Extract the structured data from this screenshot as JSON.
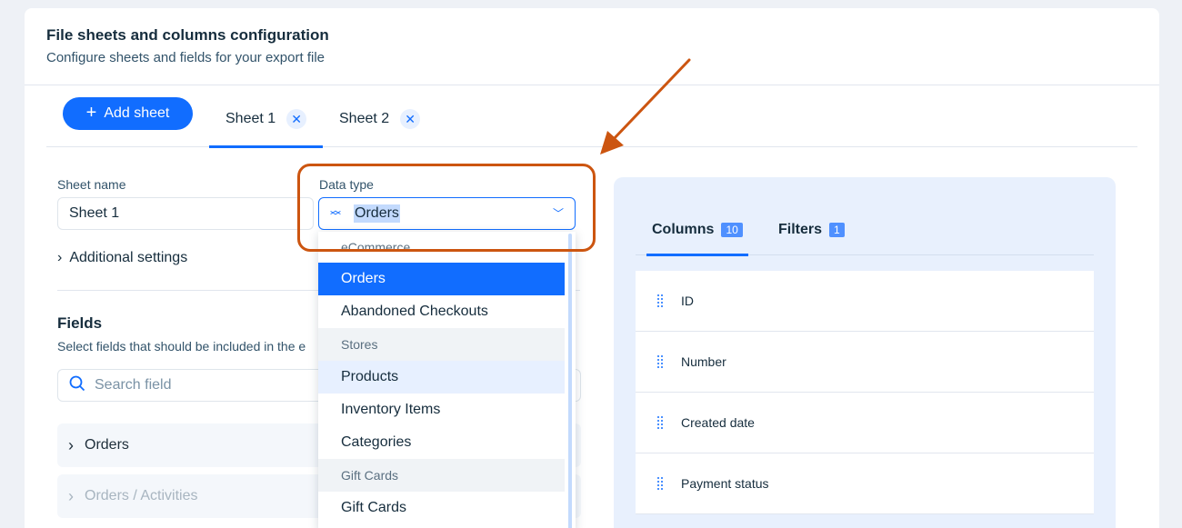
{
  "header": {
    "title": "File sheets and columns configuration",
    "subtitle": "Configure sheets and fields for your export file"
  },
  "tabs": {
    "add_label": "Add sheet",
    "sheets": [
      "Sheet 1",
      "Sheet 2"
    ]
  },
  "form": {
    "sheet_name_label": "Sheet name",
    "sheet_name_value": "Sheet 1",
    "data_type_label": "Data type",
    "data_type_value": "Orders",
    "additional_settings": "Additional settings"
  },
  "fields": {
    "title": "Fields",
    "description": "Select fields that should be included in the e",
    "search_placeholder": "Search field",
    "groups": [
      "Orders",
      "Orders / Activities"
    ]
  },
  "dropdown": {
    "items": [
      {
        "label": "eCommerce",
        "kind": "section"
      },
      {
        "label": "Orders",
        "kind": "selected"
      },
      {
        "label": "Abandoned Checkouts",
        "kind": "item"
      },
      {
        "label": "Stores",
        "kind": "section"
      },
      {
        "label": "Products",
        "kind": "hover"
      },
      {
        "label": "Inventory Items",
        "kind": "item"
      },
      {
        "label": "Categories",
        "kind": "item"
      },
      {
        "label": "Gift Cards",
        "kind": "section"
      },
      {
        "label": "Gift Cards",
        "kind": "item"
      }
    ]
  },
  "right_panel": {
    "columns_tab": "Columns",
    "columns_count": "10",
    "filters_tab": "Filters",
    "filters_count": "1",
    "columns": [
      "ID",
      "Number",
      "Created date",
      "Payment status"
    ]
  },
  "colors": {
    "accent": "#116dff",
    "annotation": "#cc5510"
  }
}
